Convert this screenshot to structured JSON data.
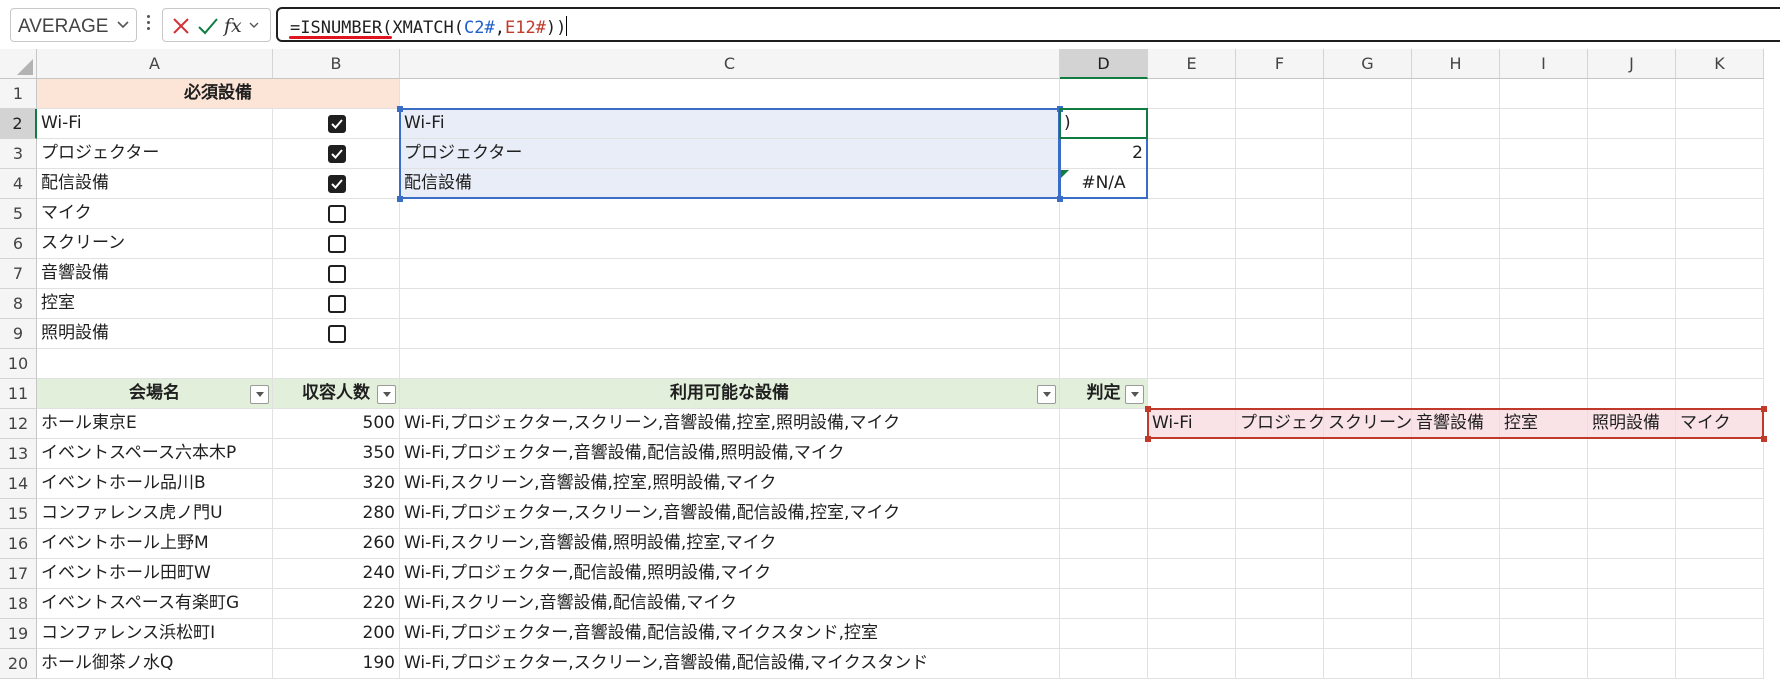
{
  "formula_bar": {
    "name_box": "AVERAGE",
    "formula_prefix": "=ISNUMBER(XMATCH(",
    "formula_ref1": "C2#",
    "formula_sep": ",",
    "formula_ref2": "E12#",
    "formula_suffix": "))"
  },
  "columns": [
    "A",
    "B",
    "C",
    "D",
    "E",
    "F",
    "G",
    "H",
    "I",
    "J",
    "K"
  ],
  "rows": [
    "1",
    "2",
    "3",
    "4",
    "5",
    "6",
    "7",
    "8",
    "9",
    "10",
    "11",
    "12",
    "13",
    "14",
    "15",
    "16",
    "17",
    "18",
    "19",
    "20"
  ],
  "active_cell": "D2",
  "required_header": "必須設備",
  "equipment": [
    {
      "name": "Wi-Fi",
      "checked": true
    },
    {
      "name": "プロジェクター",
      "checked": true
    },
    {
      "name": "配信設備",
      "checked": true
    },
    {
      "name": "マイク",
      "checked": false
    },
    {
      "name": "スクリーン",
      "checked": false
    },
    {
      "name": "音響設備",
      "checked": false
    },
    {
      "name": "控室",
      "checked": false
    },
    {
      "name": "照明設備",
      "checked": false
    }
  ],
  "spill_c": [
    "Wi-Fi",
    "プロジェクター",
    "配信設備"
  ],
  "d_values": [
    ")",
    "2",
    "#N/A"
  ],
  "table": {
    "headers": [
      "会場名",
      "収容人数",
      "利用可能な設備",
      "判定"
    ],
    "rows": [
      {
        "name": "ホール東京E",
        "cap": "500",
        "eq": "Wi-Fi,プロジェクター,スクリーン,音響設備,控室,照明設備,マイク"
      },
      {
        "name": "イベントスペース六本木P",
        "cap": "350",
        "eq": "Wi-Fi,プロジェクター,音響設備,配信設備,照明設備,マイク"
      },
      {
        "name": "イベントホール品川B",
        "cap": "320",
        "eq": "Wi-Fi,スクリーン,音響設備,控室,照明設備,マイク"
      },
      {
        "name": "コンファレンス虎ノ門U",
        "cap": "280",
        "eq": "Wi-Fi,プロジェクター,スクリーン,音響設備,配信設備,控室,マイク"
      },
      {
        "name": "イベントホール上野M",
        "cap": "260",
        "eq": "Wi-Fi,スクリーン,音響設備,照明設備,控室,マイク"
      },
      {
        "name": "イベントホール田町W",
        "cap": "240",
        "eq": "Wi-Fi,プロジェクター,配信設備,照明設備,マイク"
      },
      {
        "name": "イベントスペース有楽町G",
        "cap": "220",
        "eq": "Wi-Fi,スクリーン,音響設備,配信設備,マイク"
      },
      {
        "name": "コンファレンス浜松町I",
        "cap": "200",
        "eq": "Wi-Fi,プロジェクター,音響設備,配信設備,マイクスタンド,控室"
      },
      {
        "name": "ホール御茶ノ水Q",
        "cap": "190",
        "eq": "Wi-Fi,プロジェクター,スクリーン,音響設備,配信設備,マイクスタンド"
      }
    ]
  },
  "split_row": [
    "Wi-Fi",
    "プロジェクター",
    "スクリーン",
    "音響設備",
    "控室",
    "照明設備",
    "マイク"
  ],
  "colors": {
    "accent_green": "#107c41",
    "range_blue": "#3a6dc6",
    "range_red": "#c0392b",
    "header_orange": "#fce4d6",
    "header_green": "#e2efda"
  }
}
